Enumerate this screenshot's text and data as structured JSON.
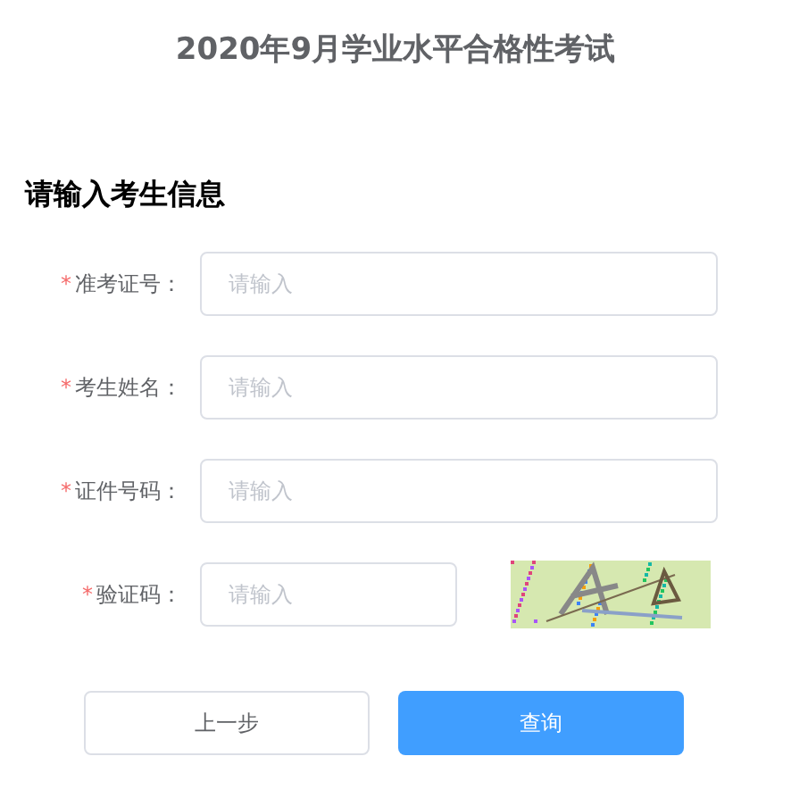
{
  "title": "2020年9月学业水平合格性考试",
  "heading": "请输入考生信息",
  "fields": [
    {
      "kind": "text",
      "required_mark": "*",
      "label": "准考证号：",
      "placeholder": "请输入"
    },
    {
      "kind": "text",
      "required_mark": "*",
      "label": "考生姓名：",
      "placeholder": "请输入"
    },
    {
      "kind": "text",
      "required_mark": "*",
      "label": "证件号码：",
      "placeholder": "请输入"
    },
    {
      "kind": "captcha",
      "required_mark": "*",
      "label": "验证码：",
      "placeholder": "请输入"
    }
  ],
  "buttons": [
    {
      "label": "上一步",
      "primary": false
    },
    {
      "label": "查询",
      "primary": true
    }
  ]
}
